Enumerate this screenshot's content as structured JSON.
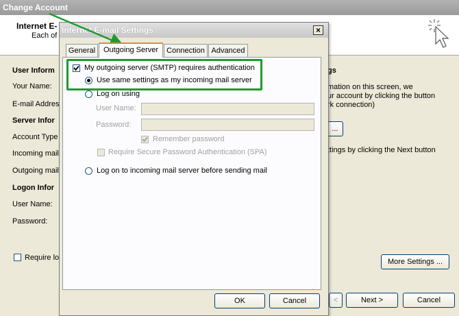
{
  "background_window": {
    "title": "Change Account",
    "header_title": "Internet E-",
    "header_subtitle": "Each of",
    "sections": {
      "user_info": "User Inform",
      "server_info": "Server Infor",
      "logon_info": "Logon Infor"
    },
    "labels": {
      "your_name": "Your Name:",
      "email_address": "E-mail Addres",
      "account_type": "Account Type",
      "incoming_mail": "Incoming mail",
      "outgoing_mail": "Outgoing mail",
      "user_name": "User Name:",
      "password": "Password:",
      "require_logon": "Require lo"
    },
    "right_texts": {
      "settings_heading": "gs",
      "info_line1": "mation on this screen, we",
      "info_line2": "ur account by clicking the button",
      "info_line3": "rk connection)",
      "next_line": "ttings by clicking the Next button"
    },
    "buttons": {
      "test": "...",
      "more_settings": "More Settings ...",
      "back": "<",
      "next": "Next >",
      "cancel": "Cancel"
    }
  },
  "dialog": {
    "title": "Internet E-mail Settings",
    "close": "×",
    "tabs": [
      "General",
      "Outgoing Server",
      "Connection",
      "Advanced"
    ],
    "active_tab": "Outgoing Server",
    "smtp_auth_label": "My outgoing server (SMTP) requires authentication",
    "smtp_auth_checked": true,
    "same_settings_label": "Use same settings as my incoming mail server",
    "logon_using_label": "Log on using",
    "user_name_label": "User Name:",
    "password_label": "Password:",
    "remember_password_label": "Remember password",
    "spa_label": "Require Secure Password Authentication (SPA)",
    "logon_incoming_label": "Log on to incoming mail server before sending mail",
    "ok": "OK",
    "cancel": "Cancel"
  },
  "colors": {
    "highlight": "#1f9a2e",
    "arrow": "#1f9a2e",
    "face": "#ECE9D8"
  }
}
